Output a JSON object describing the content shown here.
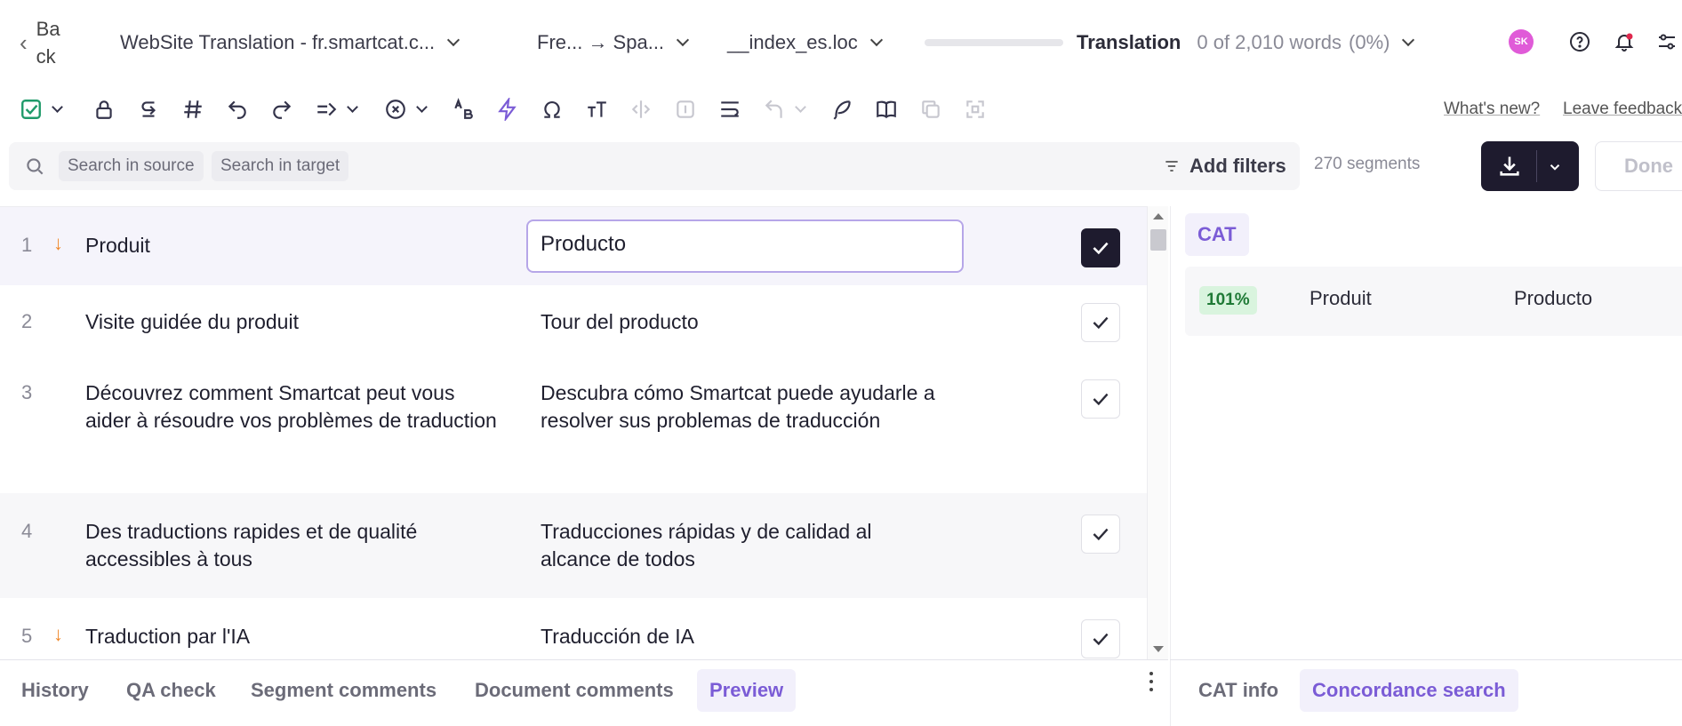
{
  "topbar": {
    "back_label": "Back",
    "project": "WebSite Translation - fr.smartcat.c...",
    "languages": "Fre... → Spa...",
    "file": "__index_es.loc",
    "stage": "Translation",
    "words": "0 of 2,010 words",
    "percent": "(0%)",
    "progress": 0,
    "avatar_initials": "SK"
  },
  "toolbar": {
    "whats_new": "What's new?",
    "leave_feedback": "Leave feedback"
  },
  "search": {
    "source_placeholder": "Search in source",
    "target_placeholder": "Search in target",
    "add_filters": "Add filters",
    "segment_count": "270 segments",
    "done_label": "Done"
  },
  "segments": [
    {
      "num": "1",
      "source": "Produit",
      "target": "Producto",
      "confirmed": true
    },
    {
      "num": "2",
      "source": "Visite guidée du produit",
      "target": "Tour del producto",
      "confirmed": false
    },
    {
      "num": "3",
      "source": "Découvrez comment Smartcat peut vous aider à résoudre vos problèmes de traduction",
      "target": "Descubra cómo Smartcat puede ayudarle a resolver sus problemas de traducción",
      "confirmed": false
    },
    {
      "num": "4",
      "source": "Des traductions rapides et de qualité accessibles à tous",
      "target": "Traducciones rápidas y de calidad al alcance de todos",
      "confirmed": false
    },
    {
      "num": "5",
      "source": "Traduction par l'IA",
      "target": "Traducción de IA",
      "confirmed": false
    }
  ],
  "bottom_tabs": [
    "History",
    "QA check",
    "Segment comments",
    "Document comments",
    "Preview"
  ],
  "right_panel": {
    "cat_tab": "CAT",
    "match": {
      "score": "101%",
      "source": "Produit",
      "target": "Producto"
    },
    "tabs": [
      "CAT info",
      "Concordance search"
    ]
  },
  "colors": {
    "accent": "#7b5cd6",
    "dark_button": "#1e1b2e",
    "arrow_orange": "#f0892c",
    "match_green_bg": "#d9f4de",
    "avatar_bg": "#e05bd8"
  }
}
